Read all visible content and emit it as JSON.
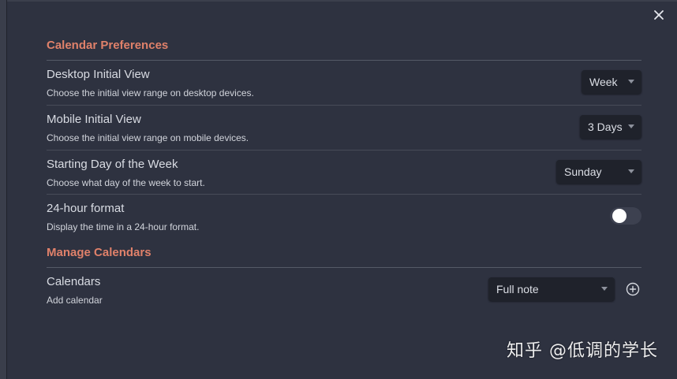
{
  "dialog": {
    "close_icon": "close-icon"
  },
  "sections": {
    "calendar_preferences": {
      "title": "Calendar Preferences",
      "desktop_view": {
        "name": "Desktop Initial View",
        "description": "Choose the initial view range on desktop devices.",
        "selected": "Week"
      },
      "mobile_view": {
        "name": "Mobile Initial View",
        "description": "Choose the initial view range on mobile devices.",
        "selected": "3 Days"
      },
      "start_day": {
        "name": "Starting Day of the Week",
        "description": "Choose what day of the week to start.",
        "selected": "Sunday"
      },
      "hour_format": {
        "name": "24-hour format",
        "description": "Display the time in a 24-hour format.",
        "enabled": false
      }
    },
    "manage_calendars": {
      "title": "Manage Calendars",
      "calendars": {
        "name": "Calendars",
        "description": "Add calendar",
        "selected": "Full note",
        "add_icon": "plus-circle-icon"
      }
    }
  },
  "watermark": "知乎 @低调的学长",
  "colors": {
    "accent": "#e0816a",
    "background": "#2e3240",
    "control_bg": "#1f222b"
  }
}
